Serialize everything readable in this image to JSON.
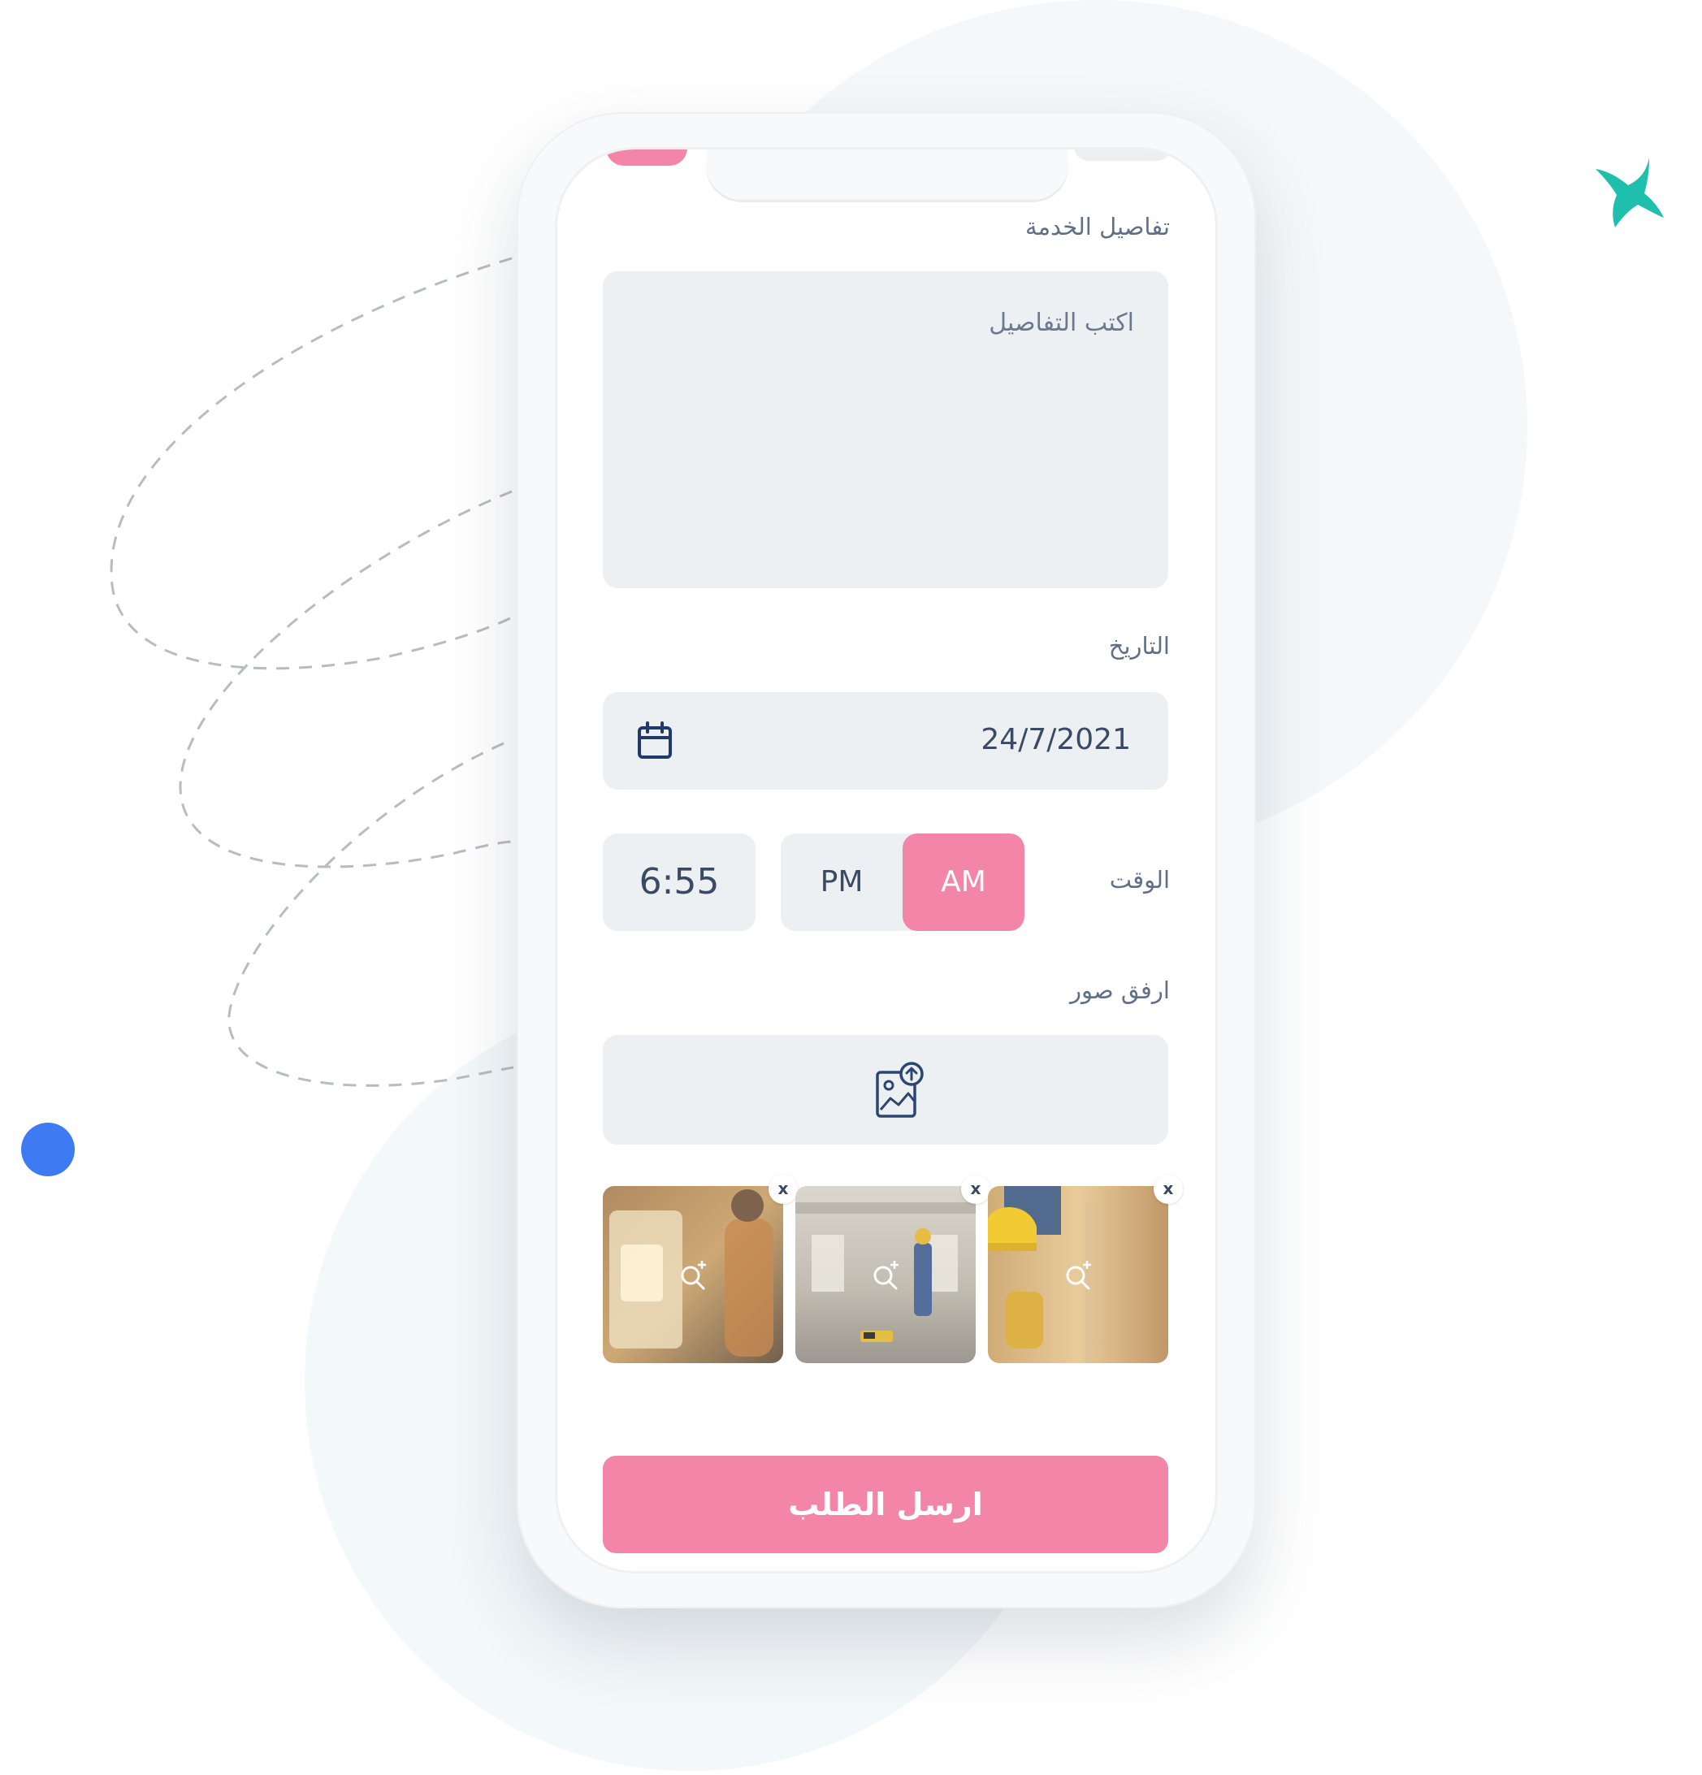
{
  "form": {
    "details_label": "تفاصيل الخدمة",
    "details_placeholder": "اكتب التفاصيل",
    "date_label": "التاريخ",
    "date_value": "24/7/2021",
    "time_label": "الوقت",
    "time_value": "6:55",
    "pm_label": "PM",
    "am_label": "AM",
    "selected_period": "AM",
    "attach_label": "ارفق صور",
    "remove_label": "x",
    "submit_label": "ارسل الطلب"
  },
  "icons": {
    "calendar": "calendar-icon",
    "upload": "image-upload-icon",
    "zoom": "zoom-in-icon",
    "star": "star-icon"
  },
  "colors": {
    "accent": "#f386a8",
    "field_bg": "#edf0f3",
    "text": "#3b4a63",
    "label": "#5e6f87",
    "teal": "#1fbfae",
    "blue": "#3e7bf2"
  }
}
